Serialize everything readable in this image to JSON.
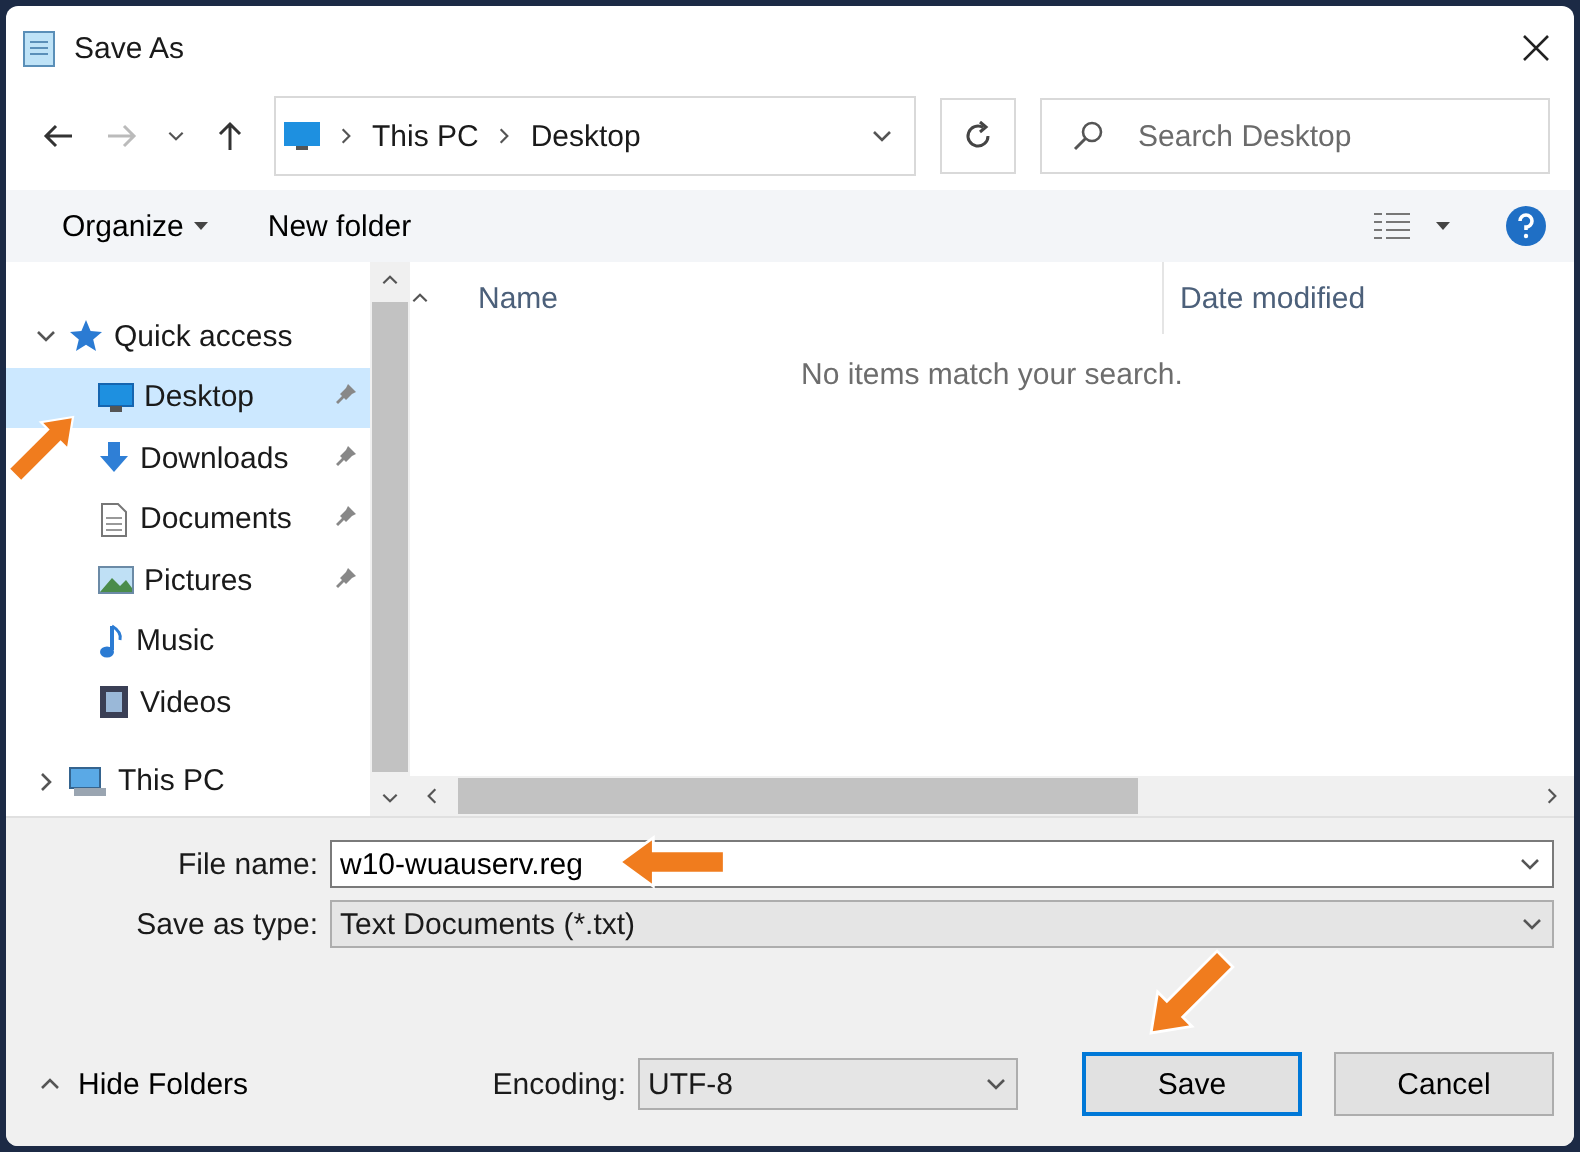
{
  "window": {
    "title": "Save As"
  },
  "address": {
    "path": [
      "This PC",
      "Desktop"
    ]
  },
  "search": {
    "placeholder": "Search Desktop"
  },
  "toolbar": {
    "organize": "Organize",
    "new_folder": "New folder"
  },
  "nav": [
    {
      "label": "Quick access",
      "kind": "star",
      "expanded": true,
      "selected": false,
      "children": [
        {
          "label": "Desktop",
          "kind": "desktop",
          "pinned": true,
          "selected": true
        },
        {
          "label": "Downloads",
          "kind": "download",
          "pinned": true,
          "selected": false
        },
        {
          "label": "Documents",
          "kind": "document",
          "pinned": true,
          "selected": false
        },
        {
          "label": "Pictures",
          "kind": "picture",
          "pinned": true,
          "selected": false
        },
        {
          "label": "Music",
          "kind": "music",
          "pinned": false,
          "selected": false
        },
        {
          "label": "Videos",
          "kind": "video",
          "pinned": false,
          "selected": false
        }
      ]
    },
    {
      "label": "This PC",
      "kind": "pc",
      "expanded": false,
      "selected": false
    }
  ],
  "columns": [
    "Name",
    "Date modified"
  ],
  "empty_message": "No items match your search.",
  "form": {
    "file_name": {
      "label": "File name:",
      "value": "w10-wuauserv.reg"
    },
    "save_type": {
      "label": "Save as type:",
      "value": "Text Documents (*.txt)"
    },
    "encoding": {
      "label": "Encoding:",
      "value": "UTF-8"
    }
  },
  "hide_folders": "Hide Folders",
  "buttons": [
    {
      "label": "Save",
      "default": true
    },
    {
      "label": "Cancel",
      "default": false
    }
  ]
}
